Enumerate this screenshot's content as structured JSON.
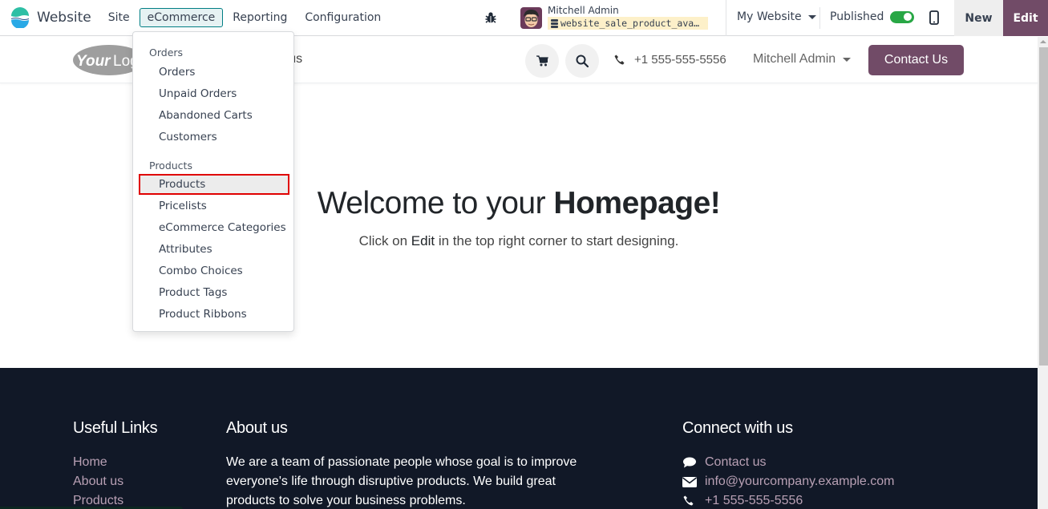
{
  "topbar": {
    "app_name": "Website",
    "menu": [
      {
        "label": "Site",
        "active": false
      },
      {
        "label": "eCommerce",
        "active": true
      },
      {
        "label": "Reporting",
        "active": false
      },
      {
        "label": "Configuration",
        "active": false
      }
    ],
    "user_name": "Mitchell Admin",
    "database": "website_sale_product_ava…",
    "website_selector": "My Website",
    "published_label": "Published",
    "published": true,
    "new_label": "New",
    "edit_label": "Edit"
  },
  "site_header": {
    "logo_text": "YourLogo",
    "nav_contact": "tact us",
    "phone": "+1 555-555-5556",
    "user": "Mitchell Admin",
    "contact_button": "Contact Us"
  },
  "dropdown": {
    "sections": [
      {
        "header": "Orders",
        "items": [
          "Orders",
          "Unpaid Orders",
          "Abandoned Carts",
          "Customers"
        ]
      },
      {
        "header": "Products",
        "items": [
          "Products",
          "Pricelists",
          "eCommerce Categories",
          "Attributes",
          "Combo Choices",
          "Product Tags",
          "Product Ribbons"
        ]
      }
    ],
    "highlighted_item": "Products"
  },
  "hero": {
    "title_prefix": "Welcome to your ",
    "title_bold": "Homepage!",
    "sub_prefix": "Click on ",
    "sub_bold": "Edit",
    "sub_suffix": " in the top right corner to start designing."
  },
  "footer": {
    "useful_links": {
      "title": "Useful Links",
      "links": [
        "Home",
        "About us",
        "Products"
      ]
    },
    "about": {
      "title": "About us",
      "text": "We are a team of passionate people whose goal is to improve everyone's life through disruptive products. We build great products to solve your business problems."
    },
    "connect": {
      "title": "Connect with us",
      "items": [
        {
          "icon": "comment-icon",
          "label": "Contact us"
        },
        {
          "icon": "envelope-icon",
          "label": "info@yourcompany.example.com"
        },
        {
          "icon": "phone-icon",
          "label": "+1 555-555-5556"
        }
      ]
    }
  },
  "colors": {
    "brand": "#714b67",
    "accent_teal": "#017e84",
    "footer_bg": "#111827",
    "footer_link": "#b8a0b4",
    "toggle_on": "#28a745",
    "highlight_border": "#e00000"
  }
}
